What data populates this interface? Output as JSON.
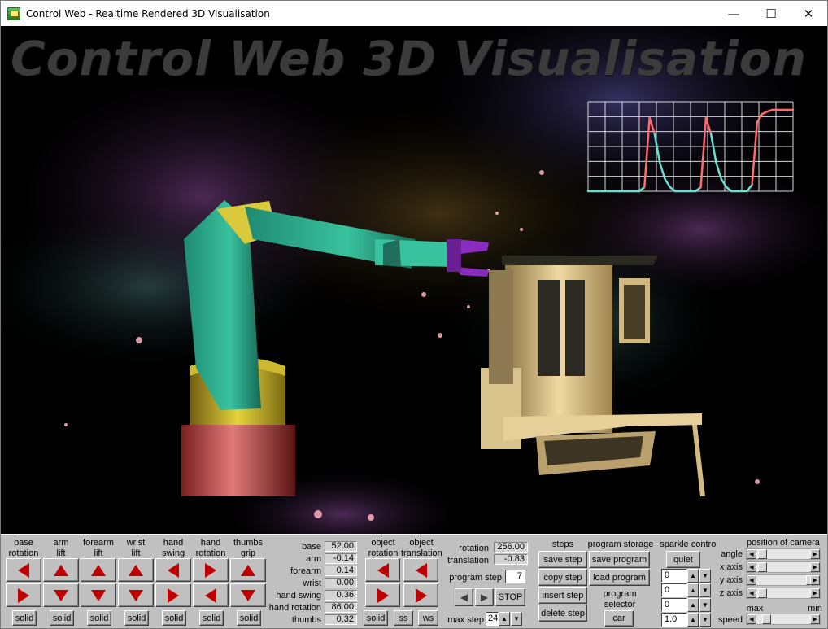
{
  "window": {
    "title": "Control Web - Realtime Rendered 3D Visualisation",
    "controls": [
      "—",
      "☐",
      "✕"
    ]
  },
  "scene": {
    "heading": "Control Web 3D Visualisation"
  },
  "joints": [
    {
      "line1": "base",
      "line2": "rotation",
      "solid": "solid",
      "top": "left",
      "bottom": "right"
    },
    {
      "line1": "arm",
      "line2": "lift",
      "solid": "solid",
      "top": "up",
      "bottom": "down"
    },
    {
      "line1": "forearm",
      "line2": "lift",
      "solid": "solid",
      "top": "up",
      "bottom": "down"
    },
    {
      "line1": "wrist",
      "line2": "lift",
      "solid": "solid",
      "top": "up",
      "bottom": "down"
    },
    {
      "line1": "hand",
      "line2": "swing",
      "solid": "solid",
      "top": "left",
      "bottom": "right"
    },
    {
      "line1": "hand",
      "line2": "rotation",
      "solid": "solid",
      "top": "right",
      "bottom": "left"
    },
    {
      "line1": "thumbs",
      "line2": "grip",
      "solid": "solid",
      "top": "up",
      "bottom": "down"
    }
  ],
  "readouts": [
    {
      "label": "base",
      "value": "52.00"
    },
    {
      "label": "arm",
      "value": "-0.14"
    },
    {
      "label": "forearm",
      "value": "0.14"
    },
    {
      "label": "wrist",
      "value": "0.00"
    },
    {
      "label": "hand swing",
      "value": "0.36"
    },
    {
      "label": "hand rotation",
      "value": "86.00"
    },
    {
      "label": "thumbs",
      "value": "0.32"
    }
  ],
  "object": {
    "rotation_label1": "object",
    "rotation_label2": "rotation",
    "translation_label1": "object",
    "translation_label2": "translation",
    "solid": "solid",
    "ss": "ss",
    "ws": "ws"
  },
  "program": {
    "rotation_label": "rotation",
    "rotation_value": "256.00",
    "translation_label": "translation",
    "translation_value": "-0.83",
    "step_label": "program step",
    "step_value": "7",
    "stop": "STOP",
    "max_step_label": "max step",
    "max_step_value": "24"
  },
  "steps": {
    "title": "steps",
    "buttons": [
      "save step",
      "copy step",
      "insert step",
      "delete step"
    ]
  },
  "storage": {
    "title": "program storage",
    "save": "save program",
    "load": "load program",
    "selector1": "program",
    "selector2": "selector",
    "car": "car"
  },
  "sparkle": {
    "title": "sparkle control",
    "quiet": "quiet",
    "values": [
      "0",
      "0",
      "0",
      "1.0"
    ]
  },
  "camera": {
    "title": "position of camera",
    "rows": [
      "angle",
      "x axis",
      "y axis",
      "z axis"
    ],
    "row_levels": [
      0.03,
      0.03,
      0.92,
      0.03
    ],
    "max": "max",
    "min": "min",
    "speed": "speed",
    "speed_level": 0.1
  },
  "mini_chart": {
    "grid_color": "#d8d8d8",
    "line_color_low": "#66e0d0",
    "line_color_high": "#ff6b6b"
  },
  "chart_data": {
    "type": "line",
    "x": [
      0,
      1,
      2,
      3,
      4,
      5,
      6,
      7,
      8,
      9,
      10,
      11,
      12,
      13,
      14,
      15,
      16,
      17,
      18,
      19,
      20,
      21,
      22,
      23,
      24,
      25,
      26,
      27,
      28,
      29,
      30,
      31,
      32,
      33,
      34,
      35,
      36,
      37,
      38,
      39,
      40
    ],
    "series": [
      {
        "values": [
          0,
          0,
          0,
          0,
          0,
          0,
          0,
          0,
          0,
          0,
          0,
          0.05,
          0.9,
          0.7,
          0.35,
          0.15,
          0.05,
          0,
          0,
          0,
          0,
          0,
          0.05,
          0.9,
          0.7,
          0.35,
          0.15,
          0.05,
          0,
          0,
          0,
          0,
          0.08,
          0.85,
          0.95,
          0.98,
          1,
          1,
          1,
          1,
          1
        ]
      }
    ],
    "xlim": [
      0,
      40
    ],
    "ylim": [
      0,
      1.1
    ],
    "grid": true
  }
}
